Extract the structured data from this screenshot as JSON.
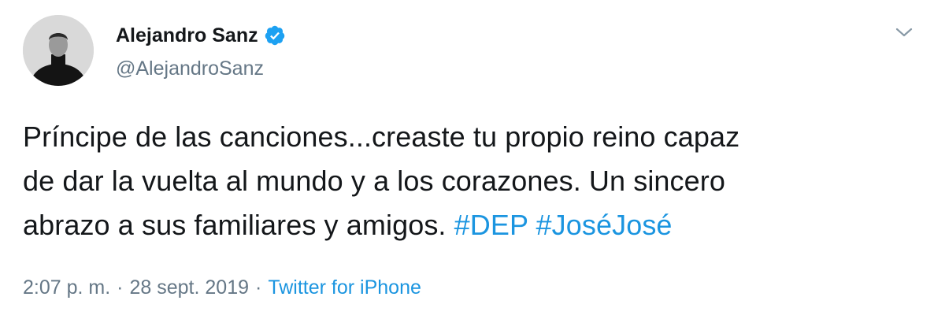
{
  "author": {
    "display_name": "Alejandro Sanz",
    "handle": "@AlejandroSanz",
    "verified": true,
    "avatar_icon": "profile-photo"
  },
  "tweet": {
    "lines": [
      "Príncipe de las canciones...creaste tu propio reino capaz",
      "de dar la vuelta al mundo y a los corazones. Un sincero",
      "abrazo a sus familiares y amigos. "
    ],
    "hashtags": [
      "#DEP",
      "#JoséJosé"
    ]
  },
  "meta": {
    "time": "2:07 p. m.",
    "separator": "·",
    "date": "28 sept. 2019",
    "source": "Twitter for iPhone"
  },
  "icons": {
    "verified": "verified-badge-icon",
    "menu": "chevron-down-icon"
  },
  "colors": {
    "link": "#1b95e0",
    "secondary_text": "#657786",
    "primary_text": "#14171a",
    "verified": "#1da1f2"
  }
}
